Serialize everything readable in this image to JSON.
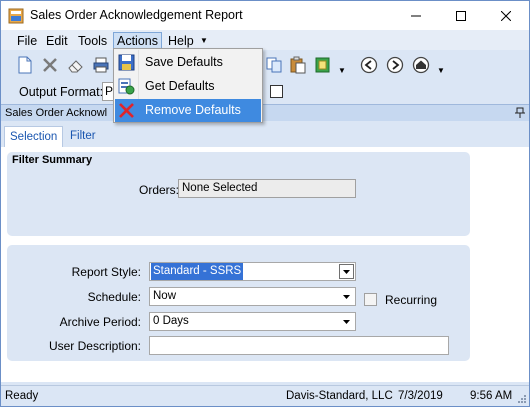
{
  "window": {
    "title": "Sales Order Acknowledgement Report",
    "controls": [
      "minimize-icon",
      "maximize-icon",
      "close-icon"
    ]
  },
  "menubar": {
    "items": [
      {
        "label": "File"
      },
      {
        "label": "Edit"
      },
      {
        "label": "Tools"
      },
      {
        "label": "Actions"
      },
      {
        "label": "Help"
      }
    ]
  },
  "toolbar": {
    "icons": [
      "new-icon",
      "delete-icon",
      "eraser-icon",
      "print-icon",
      "copy-icon",
      "paste-icon",
      "export-icon",
      "back-icon",
      "forward-icon",
      "home-icon"
    ]
  },
  "output": {
    "label": "Output Format:",
    "value": "P"
  },
  "actions_menu": {
    "items": [
      {
        "label": "Save Defaults",
        "icon": "save-defaults-icon"
      },
      {
        "label": "Get Defaults",
        "icon": "get-defaults-icon"
      },
      {
        "label": "Remove Defaults",
        "icon": "remove-defaults-icon",
        "highlighted": true
      }
    ]
  },
  "panel": {
    "title": "Sales Order Acknowl"
  },
  "tabs": [
    {
      "label": "Selection",
      "active": true
    },
    {
      "label": "Filter",
      "active": false
    }
  ],
  "filter_summary": {
    "title": "Filter Summary",
    "orders_label": "Orders:",
    "orders_value": "None Selected"
  },
  "report": {
    "style_label": "Report Style:",
    "style_value": "Standard - SSRS",
    "schedule_label": "Schedule:",
    "schedule_value": "Now",
    "recurring_label": "Recurring",
    "recurring_checked": false,
    "archive_label": "Archive Period:",
    "archive_value": "0 Days",
    "description_label": "User Description:",
    "description_value": ""
  },
  "status": {
    "state": "Ready",
    "company": "Davis-Standard, LLC",
    "date": "7/3/2019",
    "time": "9:56 AM"
  },
  "colors": {
    "accent": "#3f8ae0",
    "panel_bg": "#dbe6f5",
    "group_bg": "#dce6f4",
    "selected_field": "#3572d6"
  }
}
